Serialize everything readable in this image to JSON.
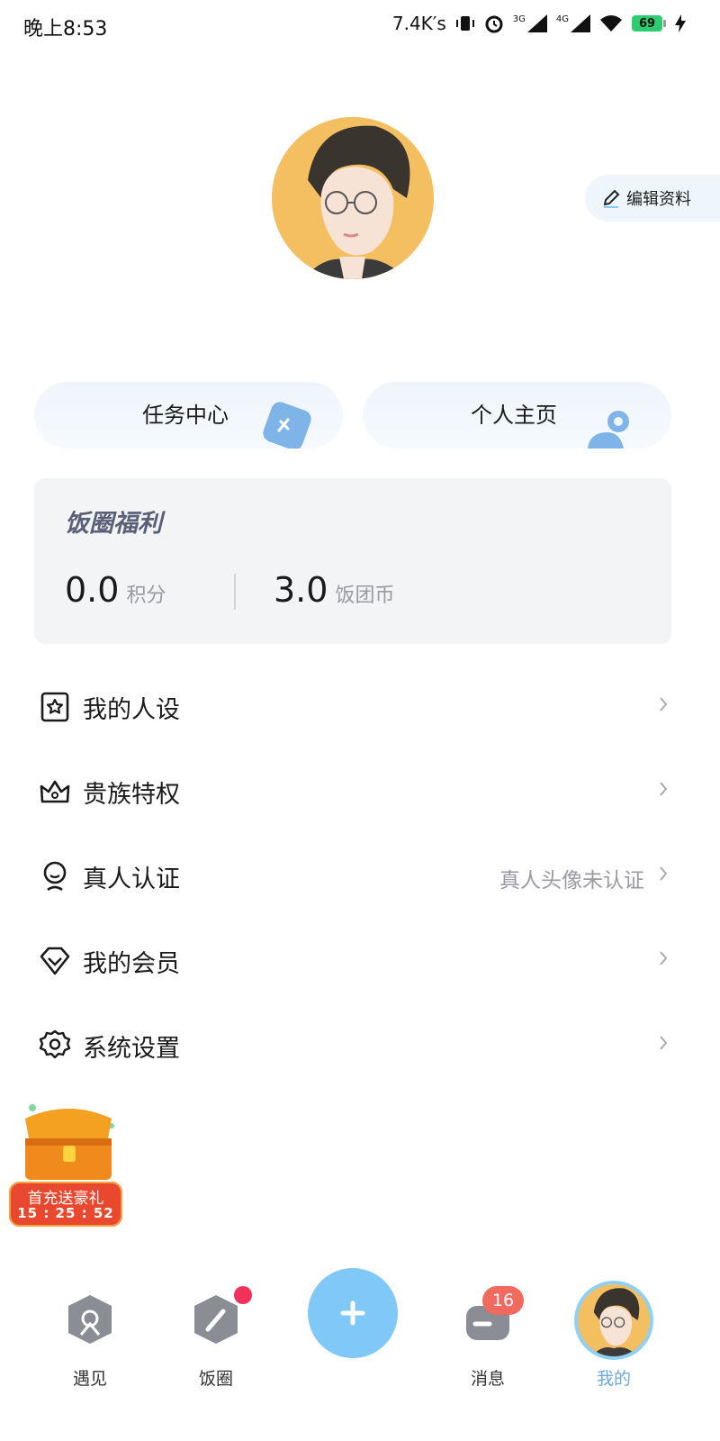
{
  "status_bar": {
    "time": "晚上8:53",
    "speed": "7.4K′s",
    "signal_1_label": "3G",
    "signal_2_label": "4G",
    "battery": "69"
  },
  "profile": {
    "edit_label": "编辑资料"
  },
  "cards": {
    "task_center": "任务中心",
    "homepage": "个人主页"
  },
  "benefits": {
    "title": "饭圈福利",
    "points_value": "0.0",
    "points_unit": "积分",
    "coins_value": "3.0",
    "coins_unit": "饭团币"
  },
  "menu": [
    {
      "label": "我的人设",
      "icon": "persona-icon",
      "extra": ""
    },
    {
      "label": "贵族特权",
      "icon": "crown-icon",
      "extra": ""
    },
    {
      "label": "真人认证",
      "icon": "face-verify-icon",
      "extra": "真人头像未认证"
    },
    {
      "label": "我的会员",
      "icon": "diamond-icon",
      "extra": ""
    },
    {
      "label": "系统设置",
      "icon": "gear-icon",
      "extra": ""
    }
  ],
  "promo": {
    "title": "首充送豪礼",
    "timer": "15 : 25 : 52"
  },
  "bottom_nav": {
    "meet": "遇见",
    "fan_circle": "饭圈",
    "messages": "消息",
    "message_badge": "16",
    "me": "我的"
  },
  "colors": {
    "accent": "#7fc8f8",
    "badge": "#f2315a",
    "benefit_title": "#5a6078"
  }
}
